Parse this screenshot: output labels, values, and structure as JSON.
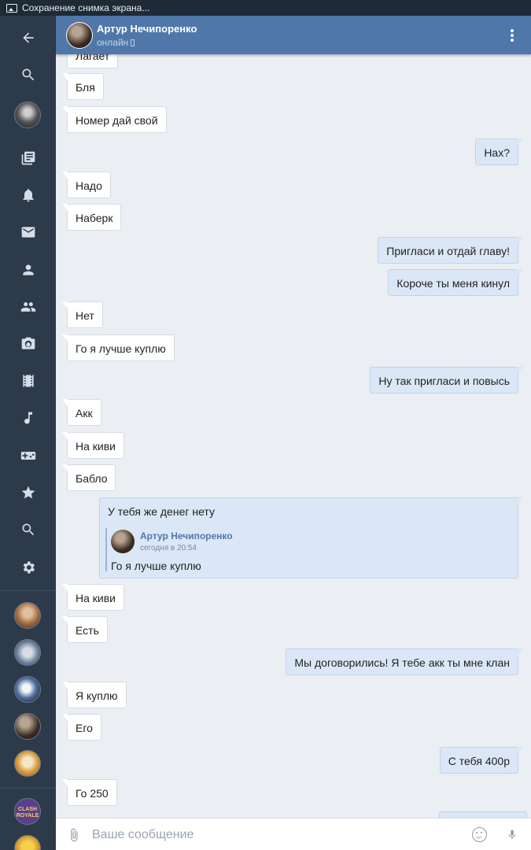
{
  "statusbar": {
    "text": "Сохранение снимка экрана..."
  },
  "header": {
    "name": "Артур Нечипоренко",
    "status": "онлайн"
  },
  "messages": [
    {
      "dir": "in",
      "text": "Лагает"
    },
    {
      "dir": "in",
      "text": "Бля"
    },
    {
      "dir": "in",
      "text": "Номер дай свой"
    },
    {
      "dir": "out",
      "text": "Нах?"
    },
    {
      "dir": "in",
      "text": "Надо"
    },
    {
      "dir": "in",
      "text": "Наберк"
    },
    {
      "dir": "out",
      "text": "Пригласи и отдай главу!"
    },
    {
      "dir": "out",
      "text": "Короче ты меня кинул"
    },
    {
      "dir": "in",
      "text": "Нет"
    },
    {
      "dir": "in",
      "text": "Го я лучше куплю"
    },
    {
      "dir": "out",
      "text": "Ну так пригласи и повысь"
    },
    {
      "dir": "in",
      "text": "Акк"
    },
    {
      "dir": "in",
      "text": "На киви"
    },
    {
      "dir": "in",
      "text": "Бабло"
    },
    {
      "dir": "in",
      "text": "На киви"
    },
    {
      "dir": "in",
      "text": "Есть"
    },
    {
      "dir": "out",
      "text": "Мы договорились! Я тебе акк ты мне клан"
    },
    {
      "dir": "in",
      "text": "Я куплю"
    },
    {
      "dir": "in",
      "text": "Его"
    },
    {
      "dir": "out",
      "text": "С тебя 400р"
    },
    {
      "dir": "in",
      "text": "Го 250"
    }
  ],
  "reply_message": {
    "text": "У тебя же денег нету",
    "quote_author": "Артур Нечипоренко",
    "quote_time": "сегодня в 20:54",
    "quote_text": "Го я лучше куплю"
  },
  "composer": {
    "placeholder": "Ваше сообщение"
  },
  "rail": {
    "icons": [
      "back-arrow-icon",
      "search-icon",
      "profile-avatar",
      "news-icon",
      "bell-icon",
      "mail-icon",
      "person-icon",
      "group-icon",
      "camera-icon",
      "film-icon",
      "music-icon",
      "gamepad-icon",
      "star-icon",
      "search-icon",
      "gear-icon"
    ],
    "chats": [
      "chat-avatar-1",
      "chat-avatar-2",
      "chat-avatar-3",
      "chat-avatar-4",
      "chat-avatar-5",
      "chat-avatar-clash-royale",
      "chat-avatar-7"
    ],
    "clash_label": "CLASH ROYALE"
  },
  "colors": {
    "header": "#4f77a9",
    "rail": "#2c3a4a",
    "bg": "#ebeef2",
    "outgoing": "#dbe7f6",
    "incoming": "#ffffff"
  }
}
